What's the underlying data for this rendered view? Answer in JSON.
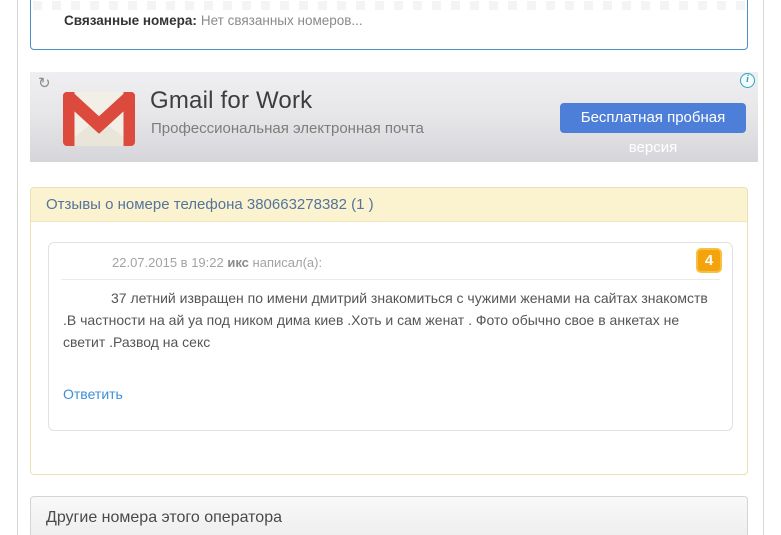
{
  "related": {
    "label": "Связанные номера:",
    "value": "Нет связанных номеров..."
  },
  "ad": {
    "title": "Gmail for Work",
    "subtitle": "Профессиональная электронная почта",
    "cta": "Бесплатная пробная версия",
    "refresh_glyph": "↻",
    "info_glyph": "i"
  },
  "reviews": {
    "header": "Отзывы о номере телефона 380663278382 (1 )",
    "comment": {
      "date": "22.07.2015 в 19:22",
      "author": "икс",
      "wrote": "написал(а):",
      "rating": "4",
      "text": "37 летний извращен по имени дмитрий знакомиться с чужими женами на сайтах знакомств .В частности на ай уа под ником дима киев .Хоть и сам женат . Фото обычно свое в анкетах не светит .Развод на секс",
      "reply": "Ответить"
    }
  },
  "other": {
    "header": "Другие номера этого оператора"
  },
  "colors": {
    "related_border_blue": "#4a90c7",
    "cta_blue": "#4d7ed8",
    "badge_orange": "#f4a30c",
    "link_blue": "#3e8ed8",
    "reviews_header_bg": "#fbf2d0",
    "gmail_red": "#dc4a3d"
  }
}
